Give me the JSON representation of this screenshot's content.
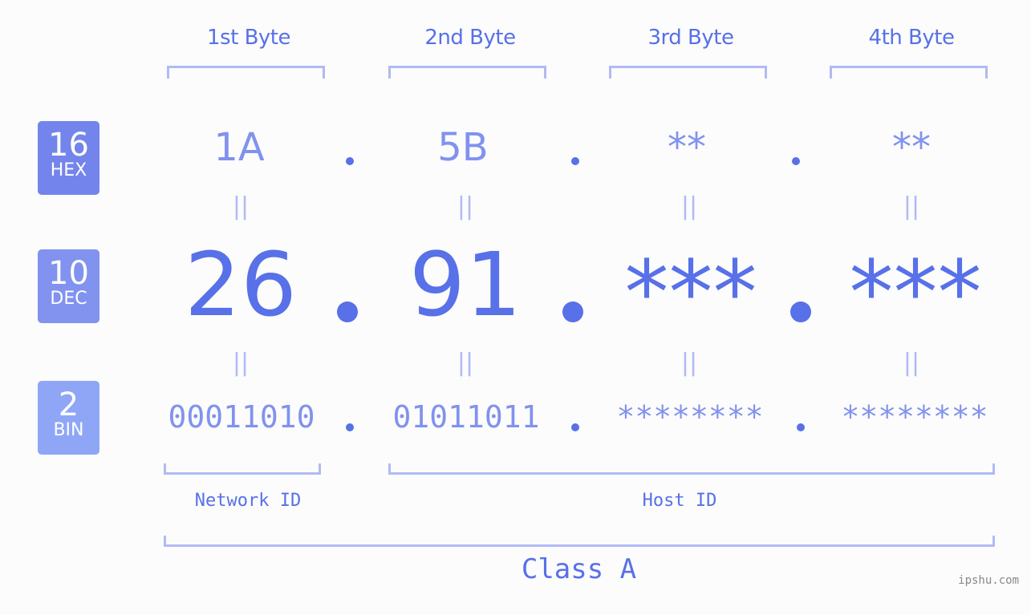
{
  "colors": {
    "primary": "#5870e8",
    "secondary": "#8192ee",
    "bracket": "#b1baf5",
    "hex_badge": "#7385ec",
    "dec_badge": "#8192ef",
    "bin_badge": "#8fa6f7",
    "background": "#fbfcfb"
  },
  "bytes": [
    {
      "label": "1st Byte",
      "hex": "1A",
      "dec": "26",
      "bin": "00011010"
    },
    {
      "label": "2nd Byte",
      "hex": "5B",
      "dec": "91",
      "bin": "01011011"
    },
    {
      "label": "3rd Byte",
      "hex": "**",
      "dec": "***",
      "bin": "********"
    },
    {
      "label": "4th Byte",
      "hex": "**",
      "dec": "***",
      "bin": "********"
    }
  ],
  "bases": {
    "hex": {
      "number": "16",
      "label": "HEX"
    },
    "dec": {
      "number": "10",
      "label": "DEC"
    },
    "bin": {
      "number": "2",
      "label": "BIN"
    }
  },
  "equals_symbol": "||",
  "parts": {
    "network": "Network ID",
    "host": "Host ID"
  },
  "ip_class": "Class A",
  "watermark": "ipshu.com"
}
